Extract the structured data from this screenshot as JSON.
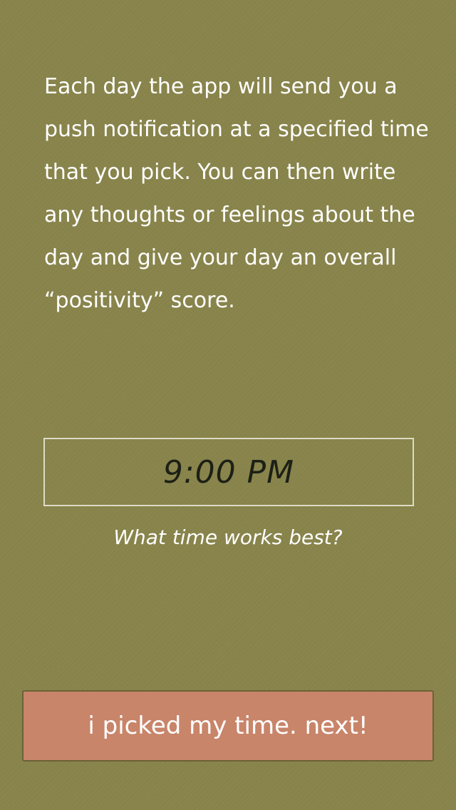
{
  "onboarding": {
    "description": "Each day the app will send you a push notification at a specified time that you pick. You can then write any thoughts or feelings about the day and give your day an overall “positivity” score.",
    "time_picker": {
      "value": "9:00 PM",
      "caption": "What time works best?"
    },
    "next_button_label": "i picked my time. next!"
  },
  "colors": {
    "background": "#88844b",
    "button": "#c8856a",
    "text": "#ffffff",
    "time_text": "#1c2016"
  }
}
